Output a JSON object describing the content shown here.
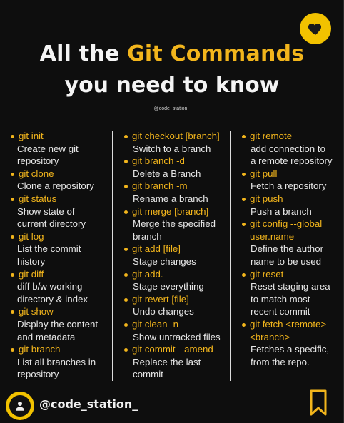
{
  "header": {
    "title_prefix": "All the ",
    "title_highlight": "Git Commands",
    "title_line2": "you need to know",
    "small_handle": "@code_station_"
  },
  "columns": [
    [
      {
        "cmd": [
          "git init"
        ],
        "desc": [
          "Create new git",
          "repository"
        ]
      },
      {
        "cmd": [
          "git clone"
        ],
        "desc": [
          "Clone a repository"
        ]
      },
      {
        "cmd": [
          "git status"
        ],
        "desc": [
          "Show state of",
          "current directory"
        ]
      },
      {
        "cmd": [
          "git log"
        ],
        "desc": [
          "List the commit",
          "history"
        ]
      },
      {
        "cmd": [
          "git diff"
        ],
        "desc": [
          "diff b/w working",
          "directory & index"
        ]
      },
      {
        "cmd": [
          "git show"
        ],
        "desc": [
          "Display the content",
          "and metadata"
        ]
      },
      {
        "cmd": [
          "git branch"
        ],
        "desc": [
          "List all branches in",
          "repository"
        ]
      }
    ],
    [
      {
        "cmd": [
          "git checkout [branch]"
        ],
        "desc": [
          "Switch to a branch"
        ]
      },
      {
        "cmd": [
          "git branch -d"
        ],
        "desc": [
          "Delete a Branch"
        ]
      },
      {
        "cmd": [
          "git branch -m"
        ],
        "desc": [
          "Rename a branch"
        ]
      },
      {
        "cmd": [
          "git merge [branch]"
        ],
        "desc": [
          "Merge the specified",
          "branch"
        ]
      },
      {
        "cmd": [
          "git add [file]"
        ],
        "desc": [
          "Stage changes"
        ]
      },
      {
        "cmd": [
          "git add."
        ],
        "desc": [
          "Stage everything"
        ]
      },
      {
        "cmd": [
          "git revert [file]"
        ],
        "desc": [
          "Undo changes"
        ]
      },
      {
        "cmd": [
          "git clean -n"
        ],
        "desc": [
          "Show untracked files"
        ]
      },
      {
        "cmd": [
          "git commit --amend"
        ],
        "desc": [
          "Replace the last",
          "commit"
        ]
      }
    ],
    [
      {
        "cmd": [
          "git remote"
        ],
        "desc": [
          "add connection to",
          "a remote repository"
        ]
      },
      {
        "cmd": [
          "git pull"
        ],
        "desc": [
          "Fetch a repository"
        ]
      },
      {
        "cmd": [
          "git push"
        ],
        "desc": [
          "Push a branch"
        ]
      },
      {
        "cmd": [
          "git config --global",
          "user.name"
        ],
        "desc": [
          "Define the author",
          "name to be used"
        ]
      },
      {
        "cmd": [
          "git reset"
        ],
        "desc": [
          "Reset staging area",
          "to match most",
          "recent commit"
        ]
      },
      {
        "cmd": [
          "git fetch <remote>",
          "<branch>"
        ],
        "desc": [
          "Fetches a specific,",
          "from the repo."
        ]
      }
    ]
  ],
  "footer": {
    "handle": "@code_station_"
  },
  "icons": {
    "like": "heart-icon",
    "avatar": "user-avatar-icon",
    "save": "bookmark-icon"
  },
  "colors": {
    "accent": "#f2b51c",
    "background": "#0e0e0e",
    "text": "#e6e6e6"
  }
}
